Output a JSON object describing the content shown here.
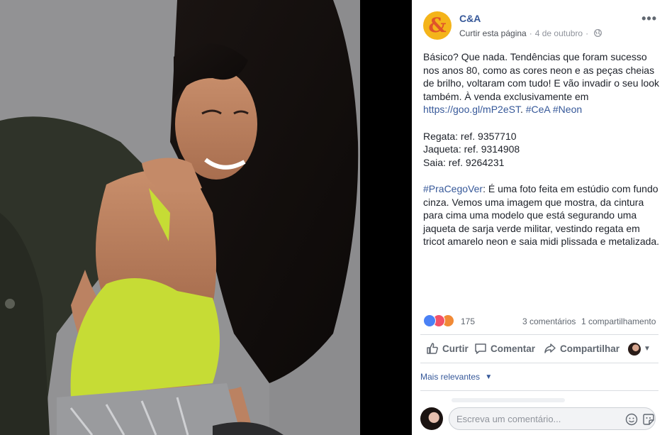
{
  "post": {
    "page_name": "C&A",
    "avatar_glyph": "&",
    "like_page": "Curtir esta página",
    "separator": "·",
    "date": "4 de outubro",
    "audience_icon": "globe-icon",
    "more": "•••",
    "paragraphs": [
      {
        "text": "Básico? Que nada. Tendências que foram sucesso nos anos 80, como as cores neon e as peças cheias de brilho, voltaram com tudo! E vão invadir o seu look também. À venda exclusivamente em ",
        "link": "https://goo.gl/mP2eST",
        "tail_space": ". ",
        "hashtags": "#CeA #Neon"
      }
    ],
    "refs": [
      "Regata: ref. 9357710",
      "Jaqueta: ref. 9314908",
      "Saia: ref. 9264231"
    ],
    "description_tag": "#PraCegoVer",
    "description": ": É uma foto feita em estúdio com fundo cinza. Vemos uma imagem que mostra, da cintura para cima uma modelo que está segurando uma jaqueta de sarja verde militar, vestindo regata em tricot amarelo neon e saia midi plissada e metalizada."
  },
  "stats": {
    "reactions": "175",
    "reaction_icons": [
      "like-icon",
      "love-icon",
      "angry-icon"
    ],
    "comments": "3 comentários",
    "shares": "1 compartilhamento"
  },
  "actions": {
    "like": "Curtir",
    "comment": "Comentar",
    "share": "Compartilhar"
  },
  "comments": {
    "sort_label": "Mais relevantes",
    "placeholder": "Escreva um comentário..."
  },
  "colors": {
    "link": "#365899",
    "avatar_bg": "#f4b41a",
    "avatar_glyph": "#e0542a",
    "like_reaction": "#4a81f5",
    "love_reaction": "#f25268",
    "angry_reaction": "#f18a36"
  }
}
